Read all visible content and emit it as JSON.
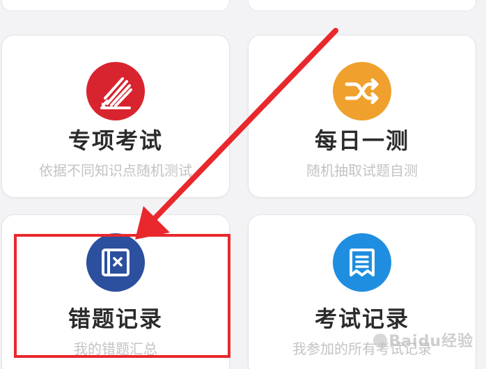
{
  "tiles": [
    {
      "title": "专项考试",
      "subtitle": "依据不同知识点随机测试",
      "icon": "pencil-edit-icon",
      "color": "#d8242e"
    },
    {
      "title": "每日一测",
      "subtitle": "随机抽取试题自测",
      "icon": "shuffle-icon",
      "color": "#f0a02c"
    },
    {
      "title": "错题记录",
      "subtitle": "我的错题汇总",
      "icon": "wrong-answer-book-icon",
      "color": "#2c4f9e"
    },
    {
      "title": "考试记录",
      "subtitle": "我参加的所有考试记录",
      "icon": "document-list-icon",
      "color": "#1f8ee0"
    }
  ],
  "annotation": {
    "arrow_color": "#e8282c",
    "highlight_color": "#e8282c"
  },
  "watermark": {
    "text": "Baidu经验"
  }
}
